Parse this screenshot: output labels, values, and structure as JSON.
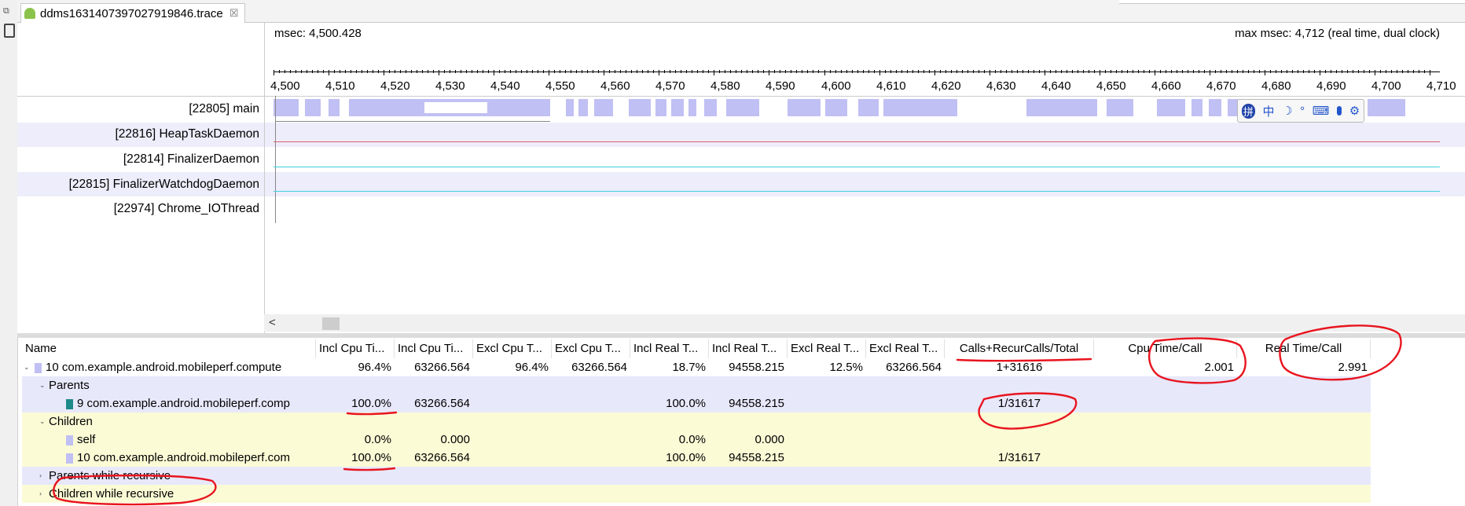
{
  "tab": {
    "title": "ddms1631407397027919846.trace",
    "close": "☒"
  },
  "header": {
    "msec": "msec: 4,500.428",
    "max_msec": "max msec: 4,712 (real time, dual clock)"
  },
  "ruler": {
    "ticks": [
      "4,500",
      "4,510",
      "4,520",
      "4,530",
      "4,540",
      "4,550",
      "4,560",
      "4,570",
      "4,580",
      "4,590",
      "4,600",
      "4,610",
      "4,620",
      "4,630",
      "4,640",
      "4,650",
      "4,660",
      "4,670",
      "4,680",
      "4,690",
      "4,700",
      "4,710"
    ]
  },
  "threads": [
    {
      "label": "[22805] main"
    },
    {
      "label": "[22816] HeapTaskDaemon"
    },
    {
      "label": "[22814] FinalizerDaemon"
    },
    {
      "label": "[22815] FinalizerWatchdogDaemon"
    },
    {
      "label": "[22974] Chrome_IOThread"
    }
  ],
  "scroll": {
    "left_arrow": "<"
  },
  "ime": {
    "icons": [
      "拼",
      "中",
      "☽",
      "°",
      "⌨",
      "🎤",
      "⚙"
    ]
  },
  "table": {
    "columns": [
      "Name",
      "Incl Cpu Ti...",
      "Incl Cpu Ti...",
      "Excl Cpu T...",
      "Excl Cpu T...",
      "Incl Real T...",
      "Incl Real T...",
      "Excl Real T...",
      "Excl Real T...",
      "Calls+RecurCalls/Total",
      "Cpu Time/Call",
      "Real Time/Call"
    ],
    "rows": [
      {
        "name": "10 com.example.android.mobileperf.compute",
        "c1": "96.4%",
        "c2": "63266.564",
        "c3": "96.4%",
        "c4": "63266.564",
        "c5": "18.7%",
        "c6": "94558.215",
        "c7": "12.5%",
        "c8": "63266.564",
        "c9": "1+31616",
        "c10": "2.001",
        "c11": "2.991"
      },
      {
        "name": "Parents"
      },
      {
        "name": "9 com.example.android.mobileperf.comp",
        "c1": "100.0%",
        "c2": "63266.564",
        "c5": "100.0%",
        "c6": "94558.215",
        "c9": "1/31617"
      },
      {
        "name": "Children"
      },
      {
        "name": "self",
        "c1": "0.0%",
        "c2": "0.000",
        "c5": "0.0%",
        "c6": "0.000"
      },
      {
        "name": "10 com.example.android.mobileperf.com",
        "c1": "100.0%",
        "c2": "63266.564",
        "c5": "100.0%",
        "c6": "94558.215",
        "c9": "1/31617"
      },
      {
        "name": "Parents while recursive"
      },
      {
        "name": "Children while recursive"
      }
    ]
  },
  "colors": {
    "segment": "#c0c0f4",
    "band": "#ededfb",
    "yellow": "#fbfbd6",
    "annotation": "#e8141e",
    "heap_line": "#e06070",
    "cyan_line": "#40d0e0"
  }
}
